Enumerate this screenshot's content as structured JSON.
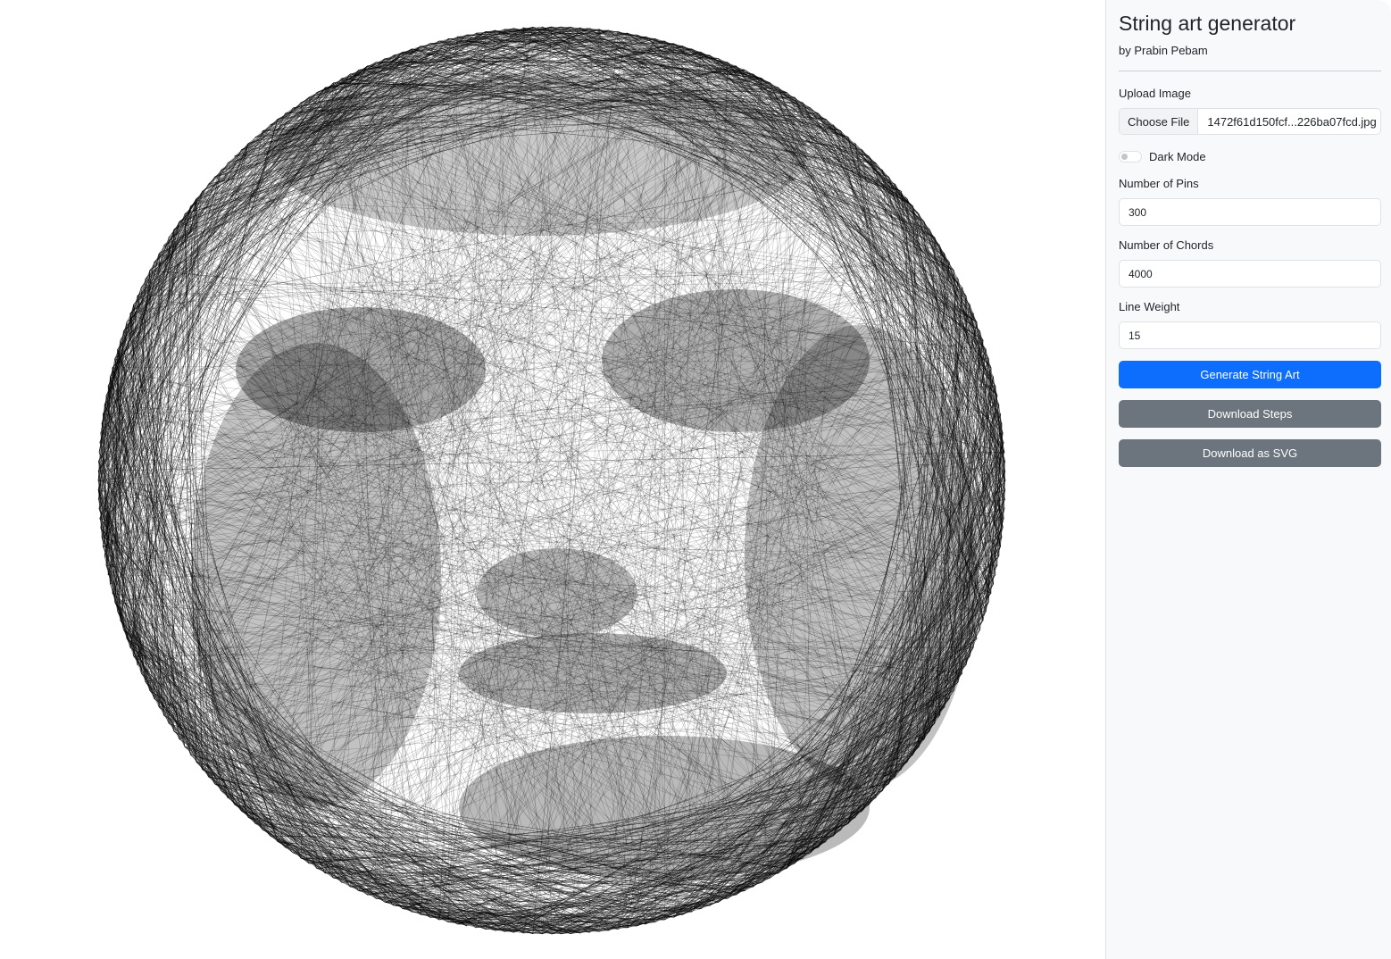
{
  "app": {
    "title": "String art generator",
    "author": "by Prabin Pebam"
  },
  "upload": {
    "label": "Upload Image",
    "button_label": "Choose File",
    "file_name": "1472f61d150fcf...226ba07fcd.jpg"
  },
  "dark_mode": {
    "label": "Dark Mode",
    "enabled": false
  },
  "fields": {
    "pins": {
      "label": "Number of Pins",
      "value": "300"
    },
    "chords": {
      "label": "Number of Chords",
      "value": "4000"
    },
    "weight": {
      "label": "Line Weight",
      "value": "15"
    }
  },
  "buttons": {
    "generate": "Generate String Art",
    "download_steps": "Download Steps",
    "download_svg": "Download as SVG"
  },
  "colors": {
    "primary": "#0d6efd",
    "secondary": "#6c757d",
    "sidebar_bg": "#f8f9fa",
    "string": "#000000"
  }
}
